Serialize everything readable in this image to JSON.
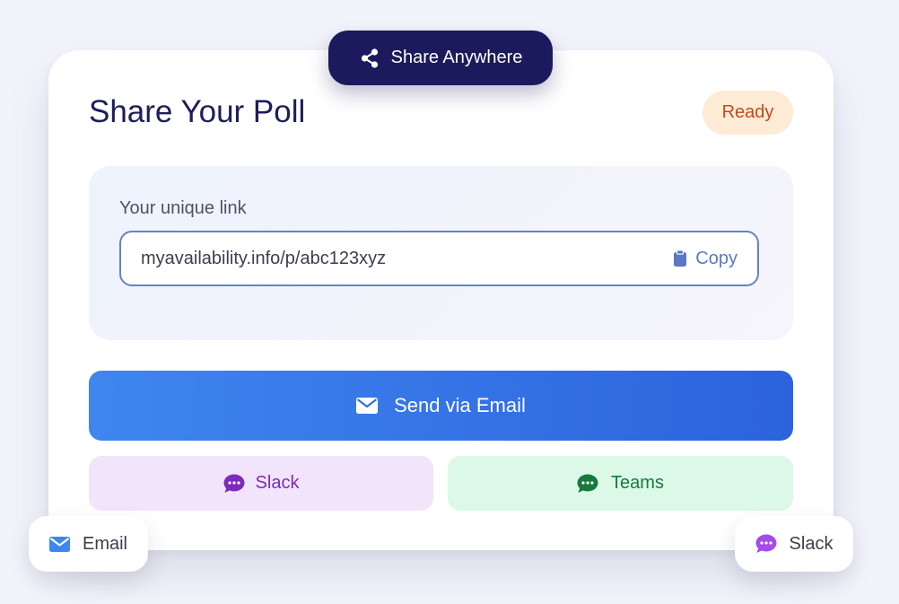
{
  "share_pill": {
    "label": "Share Anywhere",
    "icon": "share-icon"
  },
  "card": {
    "title": "Share Your Poll",
    "status": "Ready"
  },
  "link_panel": {
    "label": "Your unique link",
    "url": "myavailability.info/p/abc123xyz",
    "copy_label": "Copy",
    "copy_icon": "clipboard-icon"
  },
  "actions": {
    "email": {
      "label": "Send via Email",
      "icon": "envelope-icon"
    },
    "slack": {
      "label": "Slack",
      "icon": "chat-bubble-icon"
    },
    "teams": {
      "label": "Teams",
      "icon": "chat-bubble-icon"
    }
  },
  "floating_chips": {
    "email": {
      "label": "Email",
      "icon": "envelope-icon"
    },
    "slack": {
      "label": "Slack",
      "icon": "chat-bubble-icon"
    }
  },
  "colors": {
    "page_background": "#f3f4fb",
    "pill_navy": "#1a1a5c",
    "primary_blue": "#2c63dd",
    "status_orange": "#c24a1c",
    "slack_purple": "#7b2bbd",
    "teams_green": "#167a3e"
  }
}
